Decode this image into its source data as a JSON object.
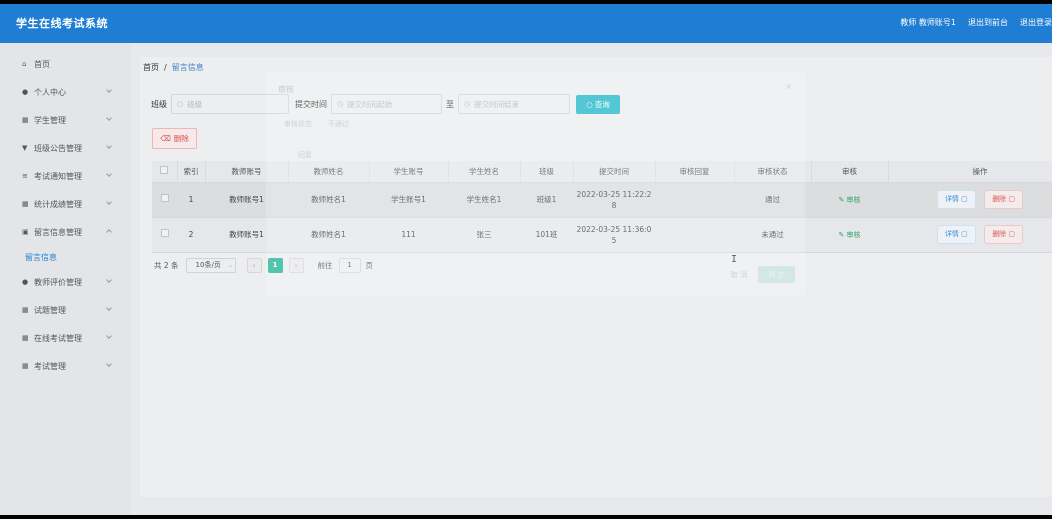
{
  "header": {
    "title": "学生在线考试系统",
    "user": "教师 教师账号1",
    "backend_link": "退出到前台",
    "logout_link": "退出登录"
  },
  "sidebar": {
    "items": [
      {
        "label": "首页",
        "icon": "home-icon",
        "arrow": false
      },
      {
        "label": "个人中心",
        "icon": "user-icon",
        "arrow": true
      },
      {
        "label": "学生管理",
        "icon": "grid-icon",
        "arrow": true
      },
      {
        "label": "班级公告管理",
        "icon": "trophy-icon",
        "arrow": true
      },
      {
        "label": "考试通知管理",
        "icon": "list-icon",
        "arrow": true
      },
      {
        "label": "统计成绩管理",
        "icon": "grid-icon",
        "arrow": true
      },
      {
        "label": "留言信息管理",
        "icon": "clipboard-icon",
        "arrow": true
      }
    ],
    "active_sub": "留言信息",
    "items_after": [
      {
        "label": "教师评价管理",
        "icon": "user-icon",
        "arrow": true
      },
      {
        "label": "试题管理",
        "icon": "grid-icon",
        "arrow": true
      },
      {
        "label": "在线考试管理",
        "icon": "grid-icon",
        "arrow": true
      },
      {
        "label": "考试管理",
        "icon": "grid-icon",
        "arrow": true
      }
    ]
  },
  "breadcrumb": {
    "home": "首页",
    "current": "留言信息"
  },
  "search": {
    "class_label": "班级",
    "class_placeholder": "班级",
    "time_label": "提交时间",
    "start_placeholder": "提交时间起始",
    "to_label": "至",
    "end_placeholder": "提交时间结束",
    "query_label": "查询"
  },
  "delete_label": "删除",
  "table": {
    "headers": [
      "索引",
      "教师账号",
      "教师姓名",
      "学生账号",
      "学生姓名",
      "班级",
      "提交时间",
      "审核回复",
      "审核状态",
      "审核",
      "操作"
    ],
    "rows": [
      {
        "index": "1",
        "teacher_account": "教师账号1",
        "teacher_name": "教师姓名1",
        "student_account": "学生账号1",
        "student_name": "学生姓名1",
        "class": "班级1",
        "time_a": "2022-03-25 11:22:2",
        "time_b": "8",
        "reply": "",
        "status": "通过",
        "audit": "审核",
        "detail": "详情",
        "delete": "删除"
      },
      {
        "index": "2",
        "teacher_account": "教师账号1",
        "teacher_name": "教师姓名1",
        "student_account": "111",
        "student_name": "张三",
        "class": "101班",
        "time_a": "2022-03-25 11:36:0",
        "time_b": "5",
        "reply": "",
        "status": "未通过",
        "audit": "审核",
        "detail": "详情",
        "delete": "删除"
      }
    ]
  },
  "pagination": {
    "total": "共 2 条",
    "page_size": "10条/页",
    "current_page": "1",
    "goto_label": "前往",
    "goto_value": "1",
    "page_label": "页"
  },
  "ghost_dialog": {
    "title": "审核",
    "field1_label": "审核状态",
    "field1_value": "不通过",
    "field2_label": "回复",
    "cancel": "取 消",
    "confirm": "确 定"
  },
  "colors": {
    "header": "#1f7ed3",
    "query_button": "#24b8c8",
    "active_page": "#23b596",
    "danger": "#e24a4a"
  }
}
